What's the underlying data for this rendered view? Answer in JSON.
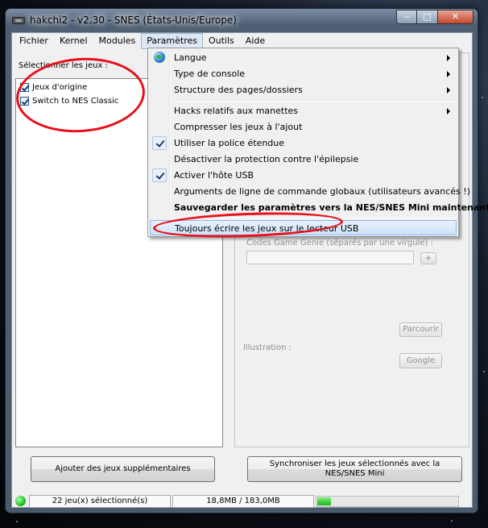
{
  "window": {
    "title": "hakchi2 - v2.30 - SNES (États-Unis/Europe)",
    "controls": {
      "minimize": "‒",
      "maximize": "□",
      "close": "✕"
    }
  },
  "menubar": {
    "items": [
      {
        "label": "Fichier"
      },
      {
        "label": "Kernel"
      },
      {
        "label": "Modules"
      },
      {
        "label": "Paramètres",
        "active": true
      },
      {
        "label": "Outils"
      },
      {
        "label": "Aide"
      }
    ]
  },
  "games": {
    "group_label": "Sélectionner les jeux :",
    "list": [
      {
        "label": "Jeux d'origine",
        "checked": true
      },
      {
        "label": "Switch to NES Classic",
        "checked": true
      }
    ]
  },
  "details": {
    "genie_label": "Codes Game Genie (séparés par une virgule) :",
    "genie_add": "+",
    "browse_button": "Parcourir",
    "illustration_label": "Illustration :",
    "google_button": "Google"
  },
  "buttons": {
    "add_games": "Ajouter des jeux supplémentaires",
    "sync": "Synchroniser les jeux sélectionnés avec la NES/SNES Mini"
  },
  "status": {
    "selected": "22 jeu(x) sélectionné(s)",
    "size": "18,8MB / 183,0MB",
    "progress_fraction": 0.1
  },
  "settings_menu": {
    "items": [
      {
        "label": "Langue",
        "submenu": true,
        "icon": "globe-icon"
      },
      {
        "label": "Type de console",
        "submenu": true
      },
      {
        "label": "Structure des pages/dossiers",
        "submenu": true
      },
      {
        "label": "Hacks relatifs aux manettes",
        "submenu": true
      },
      {
        "label": "Compresser les jeux à l'ajout"
      },
      {
        "label": "Utiliser la police étendue",
        "checked": true
      },
      {
        "label": "Désactiver la protection contre l'épilepsie"
      },
      {
        "label": "Activer l'hôte USB",
        "checked": true
      },
      {
        "label": "Arguments de ligne de commande globaux (utilisateurs avancés !)"
      },
      {
        "label": "Sauvegarder les paramètres vers la NES/SNES Mini maintenant",
        "bold": true
      },
      {
        "label": "Toujours écrire les jeux sur le lecteur USB",
        "highlighted": true
      }
    ]
  },
  "colors": {
    "annotation_red": "#e8101a",
    "menu_highlight": "#cde2f8",
    "status_green": "#1fc21f"
  }
}
